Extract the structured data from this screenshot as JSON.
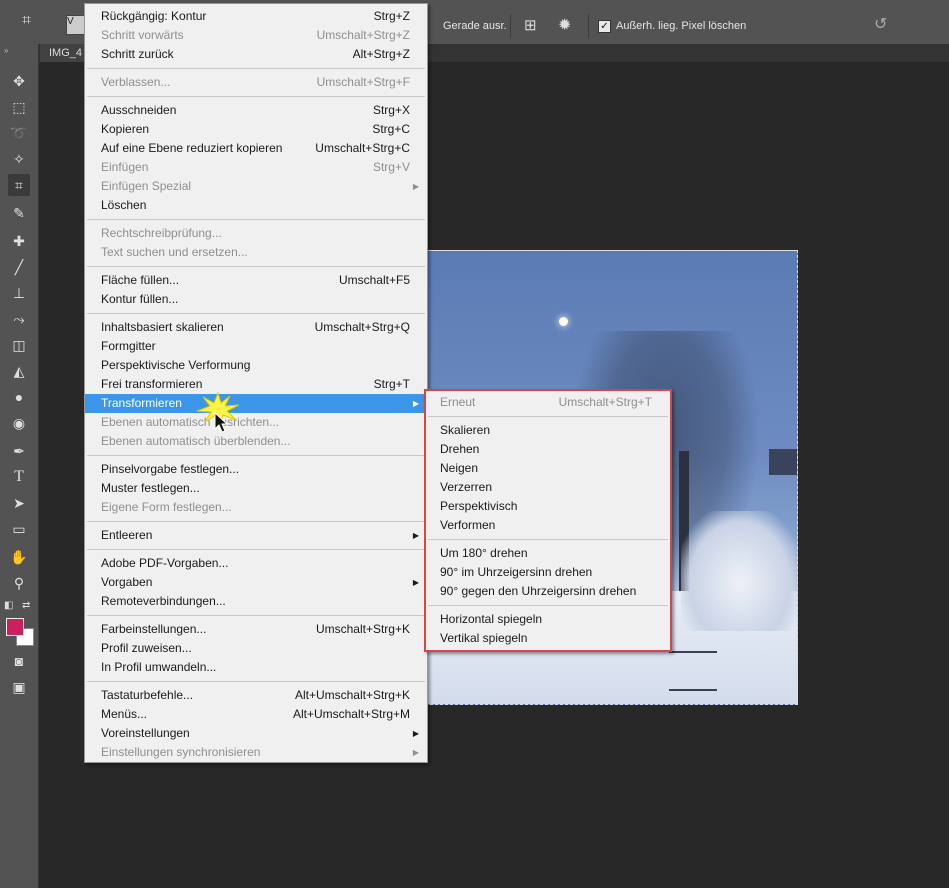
{
  "topbar": {
    "straighten_label": "Gerade ausr.",
    "delete_pixels_label": "Außerh. lieg. Pixel löschen",
    "delete_pixels_checked": true,
    "preset_label": "V"
  },
  "document": {
    "tab_label": "IMG_4"
  },
  "tools": [
    "move-tool",
    "marquee-tool",
    "lasso-tool",
    "quick-selection-tool",
    "crop-tool",
    "eyedropper-tool",
    "healing-brush-tool",
    "brush-tool",
    "clone-stamp-tool",
    "history-brush-tool",
    "eraser-tool",
    "paint-bucket-tool",
    "blur-tool",
    "dodge-tool",
    "pen-tool",
    "type-tool",
    "path-selection-tool",
    "rectangle-tool",
    "hand-tool",
    "zoom-tool"
  ],
  "colors": {
    "foreground": "#cc1f5e",
    "background": "#ffffff",
    "highlight": "#3b95e8",
    "callout_border": "#d9434a"
  },
  "edit_menu": {
    "items": [
      {
        "label": "Rückgängig: Kontur",
        "shortcut": "Strg+Z",
        "disabled": false
      },
      {
        "label": "Schritt vorwärts",
        "shortcut": "Umschalt+Strg+Z",
        "disabled": true
      },
      {
        "label": "Schritt zurück",
        "shortcut": "Alt+Strg+Z",
        "disabled": false
      },
      {
        "label": "Verblassen...",
        "shortcut": "Umschalt+Strg+F",
        "disabled": true
      },
      {
        "label": "Ausschneiden",
        "shortcut": "Strg+X",
        "disabled": false
      },
      {
        "label": "Kopieren",
        "shortcut": "Strg+C",
        "disabled": false
      },
      {
        "label": "Auf eine Ebene reduziert kopieren",
        "shortcut": "Umschalt+Strg+C",
        "disabled": false
      },
      {
        "label": "Einfügen",
        "shortcut": "Strg+V",
        "disabled": true
      },
      {
        "label": "Einfügen Spezial",
        "shortcut": "",
        "disabled": true,
        "submenu": true
      },
      {
        "label": "Löschen",
        "shortcut": "",
        "disabled": false
      },
      {
        "label": "Rechtschreibprüfung...",
        "shortcut": "",
        "disabled": true
      },
      {
        "label": "Text suchen und ersetzen...",
        "shortcut": "",
        "disabled": true
      },
      {
        "label": "Fläche füllen...",
        "shortcut": "Umschalt+F5",
        "disabled": false
      },
      {
        "label": "Kontur füllen...",
        "shortcut": "",
        "disabled": false
      },
      {
        "label": "Inhaltsbasiert skalieren",
        "shortcut": "Umschalt+Strg+Q",
        "disabled": false
      },
      {
        "label": "Formgitter",
        "shortcut": "",
        "disabled": false
      },
      {
        "label": "Perspektivische Verformung",
        "shortcut": "",
        "disabled": false
      },
      {
        "label": "Frei transformieren",
        "shortcut": "Strg+T",
        "disabled": false
      },
      {
        "label": "Transformieren",
        "shortcut": "",
        "disabled": false,
        "submenu": true,
        "highlighted": true
      },
      {
        "label": "Ebenen automatisch ausrichten...",
        "shortcut": "",
        "disabled": true
      },
      {
        "label": "Ebenen automatisch überblenden...",
        "shortcut": "",
        "disabled": true
      },
      {
        "label": "Pinselvorgabe festlegen...",
        "shortcut": "",
        "disabled": false
      },
      {
        "label": "Muster festlegen...",
        "shortcut": "",
        "disabled": false
      },
      {
        "label": "Eigene Form festlegen...",
        "shortcut": "",
        "disabled": true
      },
      {
        "label": "Entleeren",
        "shortcut": "",
        "disabled": false,
        "submenu": true
      },
      {
        "label": "Adobe PDF-Vorgaben...",
        "shortcut": "",
        "disabled": false
      },
      {
        "label": "Vorgaben",
        "shortcut": "",
        "disabled": false,
        "submenu": true
      },
      {
        "label": "Remoteverbindungen...",
        "shortcut": "",
        "disabled": false
      },
      {
        "label": "Farbeinstellungen...",
        "shortcut": "Umschalt+Strg+K",
        "disabled": false
      },
      {
        "label": "Profil zuweisen...",
        "shortcut": "",
        "disabled": false
      },
      {
        "label": "In Profil umwandeln...",
        "shortcut": "",
        "disabled": false
      },
      {
        "label": "Tastaturbefehle...",
        "shortcut": "Alt+Umschalt+Strg+K",
        "disabled": false
      },
      {
        "label": "Menüs...",
        "shortcut": "Alt+Umschalt+Strg+M",
        "disabled": false
      },
      {
        "label": "Voreinstellungen",
        "shortcut": "",
        "disabled": false,
        "submenu": true
      },
      {
        "label": "Einstellungen synchronisieren",
        "shortcut": "",
        "disabled": true,
        "submenu": true
      }
    ]
  },
  "transform_menu": {
    "items": [
      {
        "label": "Erneut",
        "shortcut": "Umschalt+Strg+T",
        "disabled": true
      },
      {
        "label": "Skalieren",
        "shortcut": "",
        "disabled": false
      },
      {
        "label": "Drehen",
        "shortcut": "",
        "disabled": false
      },
      {
        "label": "Neigen",
        "shortcut": "",
        "disabled": false
      },
      {
        "label": "Verzerren",
        "shortcut": "",
        "disabled": false
      },
      {
        "label": "Perspektivisch",
        "shortcut": "",
        "disabled": false
      },
      {
        "label": "Verformen",
        "shortcut": "",
        "disabled": false
      },
      {
        "label": "Um 180° drehen",
        "shortcut": "",
        "disabled": false
      },
      {
        "label": "90° im Uhrzeigersinn drehen",
        "shortcut": "",
        "disabled": false
      },
      {
        "label": "90° gegen den Uhrzeigersinn drehen",
        "shortcut": "",
        "disabled": false
      },
      {
        "label": "Horizontal spiegeln",
        "shortcut": "",
        "disabled": false
      },
      {
        "label": "Vertikal spiegeln",
        "shortcut": "",
        "disabled": false
      }
    ]
  }
}
